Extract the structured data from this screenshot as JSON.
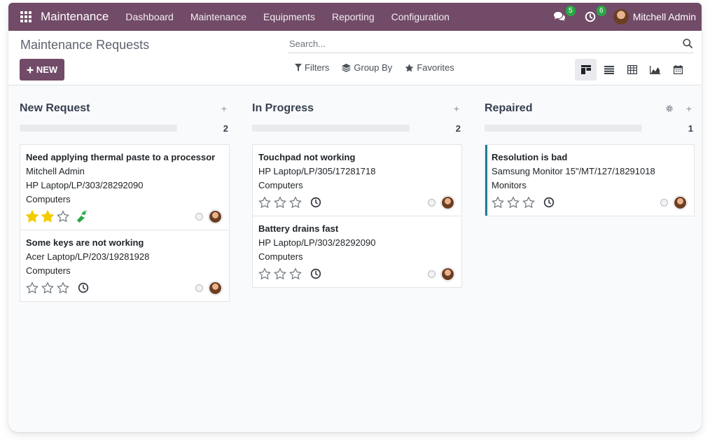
{
  "navbar": {
    "app_title": "Maintenance",
    "menu": [
      "Dashboard",
      "Maintenance",
      "Equipments",
      "Reporting",
      "Configuration"
    ],
    "messages_count": "5",
    "activities_count": "6",
    "user_name": "Mitchell Admin"
  },
  "control": {
    "breadcrumb": "Maintenance Requests",
    "search_placeholder": "Search...",
    "new_label": "NEW",
    "filters_label": "Filters",
    "groupby_label": "Group By",
    "favorites_label": "Favorites",
    "views": [
      "kanban-view-icon",
      "list-view-icon",
      "pivot-view-icon",
      "graph-view-icon",
      "calendar-view-icon"
    ]
  },
  "columns": [
    {
      "title": "New Request",
      "count": "2",
      "cards": [
        {
          "title": "Need applying thermal paste to a processor",
          "lines": [
            "Mitchell Admin",
            "HP Laptop/LP/303/28292090",
            "Computers"
          ],
          "stars": 2,
          "icon": "wrench-icon"
        },
        {
          "title": "Some keys are not working",
          "lines": [
            "Acer Laptop/LP/203/19281928",
            "Computers"
          ],
          "stars": 0,
          "icon": "clock-icon"
        }
      ]
    },
    {
      "title": "In Progress",
      "count": "2",
      "cards": [
        {
          "title": "Touchpad not working",
          "lines": [
            "HP Laptop/LP/305/17281718",
            "Computers"
          ],
          "stars": 0,
          "icon": "clock-icon"
        },
        {
          "title": "Battery drains fast",
          "lines": [
            "HP Laptop/LP/303/28292090",
            "Computers"
          ],
          "stars": 0,
          "icon": "clock-icon"
        }
      ]
    },
    {
      "title": "Repaired",
      "count": "1",
      "cards": [
        {
          "title": "Resolution is bad",
          "lines": [
            "Samsung Monitor 15\"/MT/127/18291018",
            "Monitors"
          ],
          "stars": 0,
          "icon": "clock-icon"
        }
      ]
    }
  ],
  "colors": {
    "brand": "#714b67",
    "star_filled": "#f3cc00",
    "wrench": "#28a745",
    "repaired_accent": "#1f7f8c"
  }
}
